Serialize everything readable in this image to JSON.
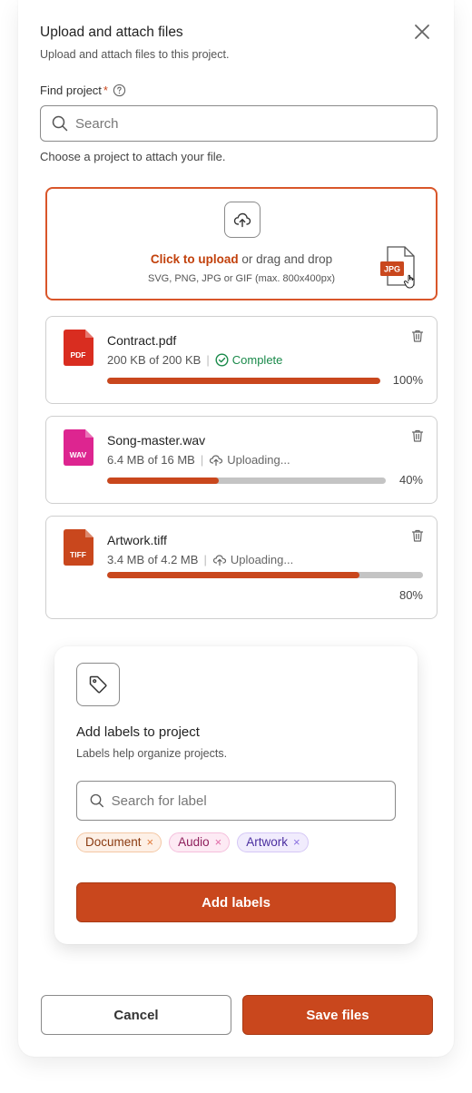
{
  "modal": {
    "title": "Upload and attach files",
    "subtitle": "Upload and attach files to this project."
  },
  "project_search": {
    "label": "Find project",
    "required_mark": "*",
    "placeholder": "Search",
    "hint": "Choose a project to attach your file."
  },
  "dropzone": {
    "link_text": "Click to upload",
    "rest_text": " or drag and drop",
    "formats": "SVG, PNG, JPG or GIF (max. 800x400px)",
    "dragged_file_type": "JPG"
  },
  "files": [
    {
      "name": "Contract.pdf",
      "type": "PDF",
      "icon_color": "#d92d20",
      "size": "200 KB of 200 KB",
      "status": "Complete",
      "status_kind": "complete",
      "progress": 100,
      "progress_label": "100%"
    },
    {
      "name": "Song-master.wav",
      "type": "WAV",
      "icon_color": "#dd2590",
      "size": "6.4 MB of 16 MB",
      "status": "Uploading...",
      "status_kind": "uploading",
      "progress": 40,
      "progress_label": "40%"
    },
    {
      "name": "Artwork.tiff",
      "type": "TIFF",
      "icon_color": "#c9471d",
      "size": "3.4 MB of 4.2 MB",
      "status": "Uploading...",
      "status_kind": "uploading",
      "progress": 80,
      "progress_label": "80%"
    }
  ],
  "labels_panel": {
    "title": "Add labels to project",
    "subtitle": "Labels help organize projects.",
    "search_placeholder": "Search for label",
    "chips": [
      "Document",
      "Audio",
      "Artwork"
    ],
    "add_button": "Add labels"
  },
  "footer": {
    "cancel": "Cancel",
    "save": "Save files"
  },
  "colors": {
    "accent": "#c9471d",
    "success": "#1a8a4a"
  }
}
